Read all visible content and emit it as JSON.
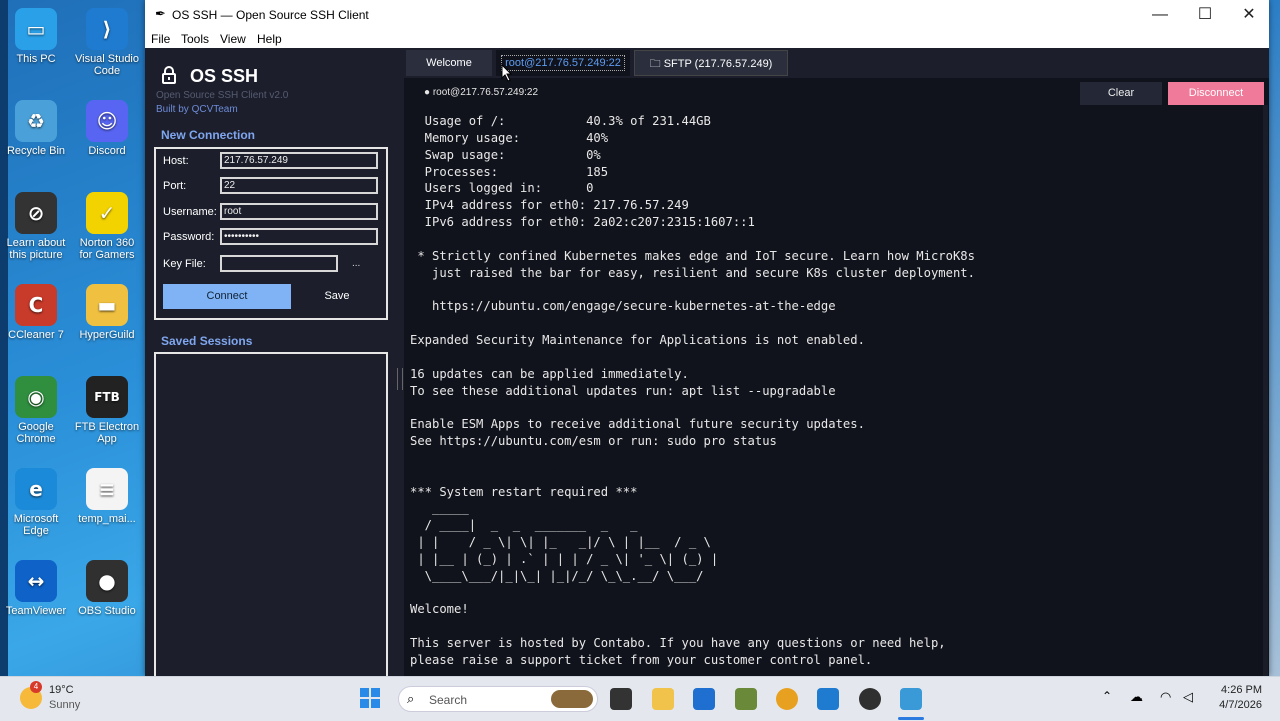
{
  "desktop": {
    "icons": [
      {
        "label": "This PC",
        "color": "#2aa0e8",
        "glyph": "▭"
      },
      {
        "label": "Visual Studio Code",
        "color": "#1f7bd0",
        "glyph": "⟩"
      },
      {
        "label": "Recycle Bin",
        "color": "#4aa0d8",
        "glyph": "♻"
      },
      {
        "label": "Discord",
        "color": "#5865f2",
        "glyph": "☺"
      },
      {
        "label": "Learn about this picture",
        "color": "#333",
        "glyph": "⊘"
      },
      {
        "label": "Norton 360 for Gamers",
        "color": "#f2d300",
        "glyph": "✓"
      },
      {
        "label": "CCleaner 7",
        "color": "#c83a2a",
        "glyph": "C"
      },
      {
        "label": "HyperGuild",
        "color": "#f0c040",
        "glyph": "▬"
      },
      {
        "label": "Google Chrome",
        "color": "#2f8f3f",
        "glyph": "◉"
      },
      {
        "label": "FTB Electron App",
        "color": "#222",
        "glyph": "FTB"
      },
      {
        "label": "Microsoft Edge",
        "color": "#1b8ad8",
        "glyph": "e"
      },
      {
        "label": "temp_mai...",
        "color": "#f4f4f4",
        "glyph": "≡"
      },
      {
        "label": "TeamViewer",
        "color": "#0e62c8",
        "glyph": "↔"
      },
      {
        "label": "OBS Studio",
        "color": "#303030",
        "glyph": "●"
      }
    ]
  },
  "window": {
    "title": "OS SSH — Open Source SSH Client",
    "menu": [
      "File",
      "Tools",
      "View",
      "Help"
    ]
  },
  "sidebar": {
    "app_name": "OS SSH",
    "tagline": "Open Source SSH Client  v2.0",
    "built_by": "Built by QCVTeam",
    "new_connection_title": "New Connection",
    "fields": {
      "host_label": "Host:",
      "host_value": "217.76.57.249",
      "port_label": "Port:",
      "port_value": "22",
      "username_label": "Username:",
      "username_value": "root",
      "password_label": "Password:",
      "password_value": "••••••••••",
      "keyfile_label": "Key File:",
      "keyfile_value": "",
      "browse_label": "..."
    },
    "connect_label": "Connect",
    "save_label": "Save",
    "saved_sessions_title": "Saved Sessions"
  },
  "tabs": {
    "welcome": "Welcome",
    "session": "root@217.76.57.249:22",
    "sftp": "SFTP (217.76.57.249)"
  },
  "session_bar": {
    "status": "● root@217.76.57.249:22",
    "clear_label": "Clear",
    "disconnect_label": "Disconnect"
  },
  "terminal": {
    "lines": [
      "  Usage of /:           40.3% of 231.44GB",
      "  Memory usage:         40%",
      "  Swap usage:           0%",
      "  Processes:            185",
      "  Users logged in:      0",
      "  IPv4 address for eth0: 217.76.57.249",
      "  IPv6 address for eth0: 2a02:c207:2315:1607::1",
      "",
      " * Strictly confined Kubernetes makes edge and IoT secure. Learn how MicroK8s",
      "   just raised the bar for easy, resilient and secure K8s cluster deployment.",
      "",
      "   https://ubuntu.com/engage/secure-kubernetes-at-the-edge",
      "",
      "Expanded Security Maintenance for Applications is not enabled.",
      "",
      "16 updates can be applied immediately.",
      "To see these additional updates run: apt list --upgradable",
      "",
      "Enable ESM Apps to receive additional future security updates.",
      "See https://ubuntu.com/esm or run: sudo pro status",
      "",
      "",
      "*** System restart required ***",
      "   _____",
      "  / ____|  _  _  _______  _   _",
      " | |    / _ \\| \\| |_   _|/ \\ | |__  / _ \\",
      " | |__ | (_) | .` | | | / _ \\| '_ \\| (_) |",
      "  \\____\\___/|_|\\_| |_|/_/ \\_\\_.__/ \\___/",
      "",
      "Welcome!",
      "",
      "This server is hosted by Contabo. If you have any questions or need help,",
      "please raise a support ticket from your customer control panel."
    ]
  },
  "taskbar": {
    "weather_temp": "19°C",
    "weather_desc": "Sunny",
    "search_placeholder": "Search",
    "time": "4:26 PM",
    "date": "4/7/2026",
    "weather_badge": "4"
  }
}
